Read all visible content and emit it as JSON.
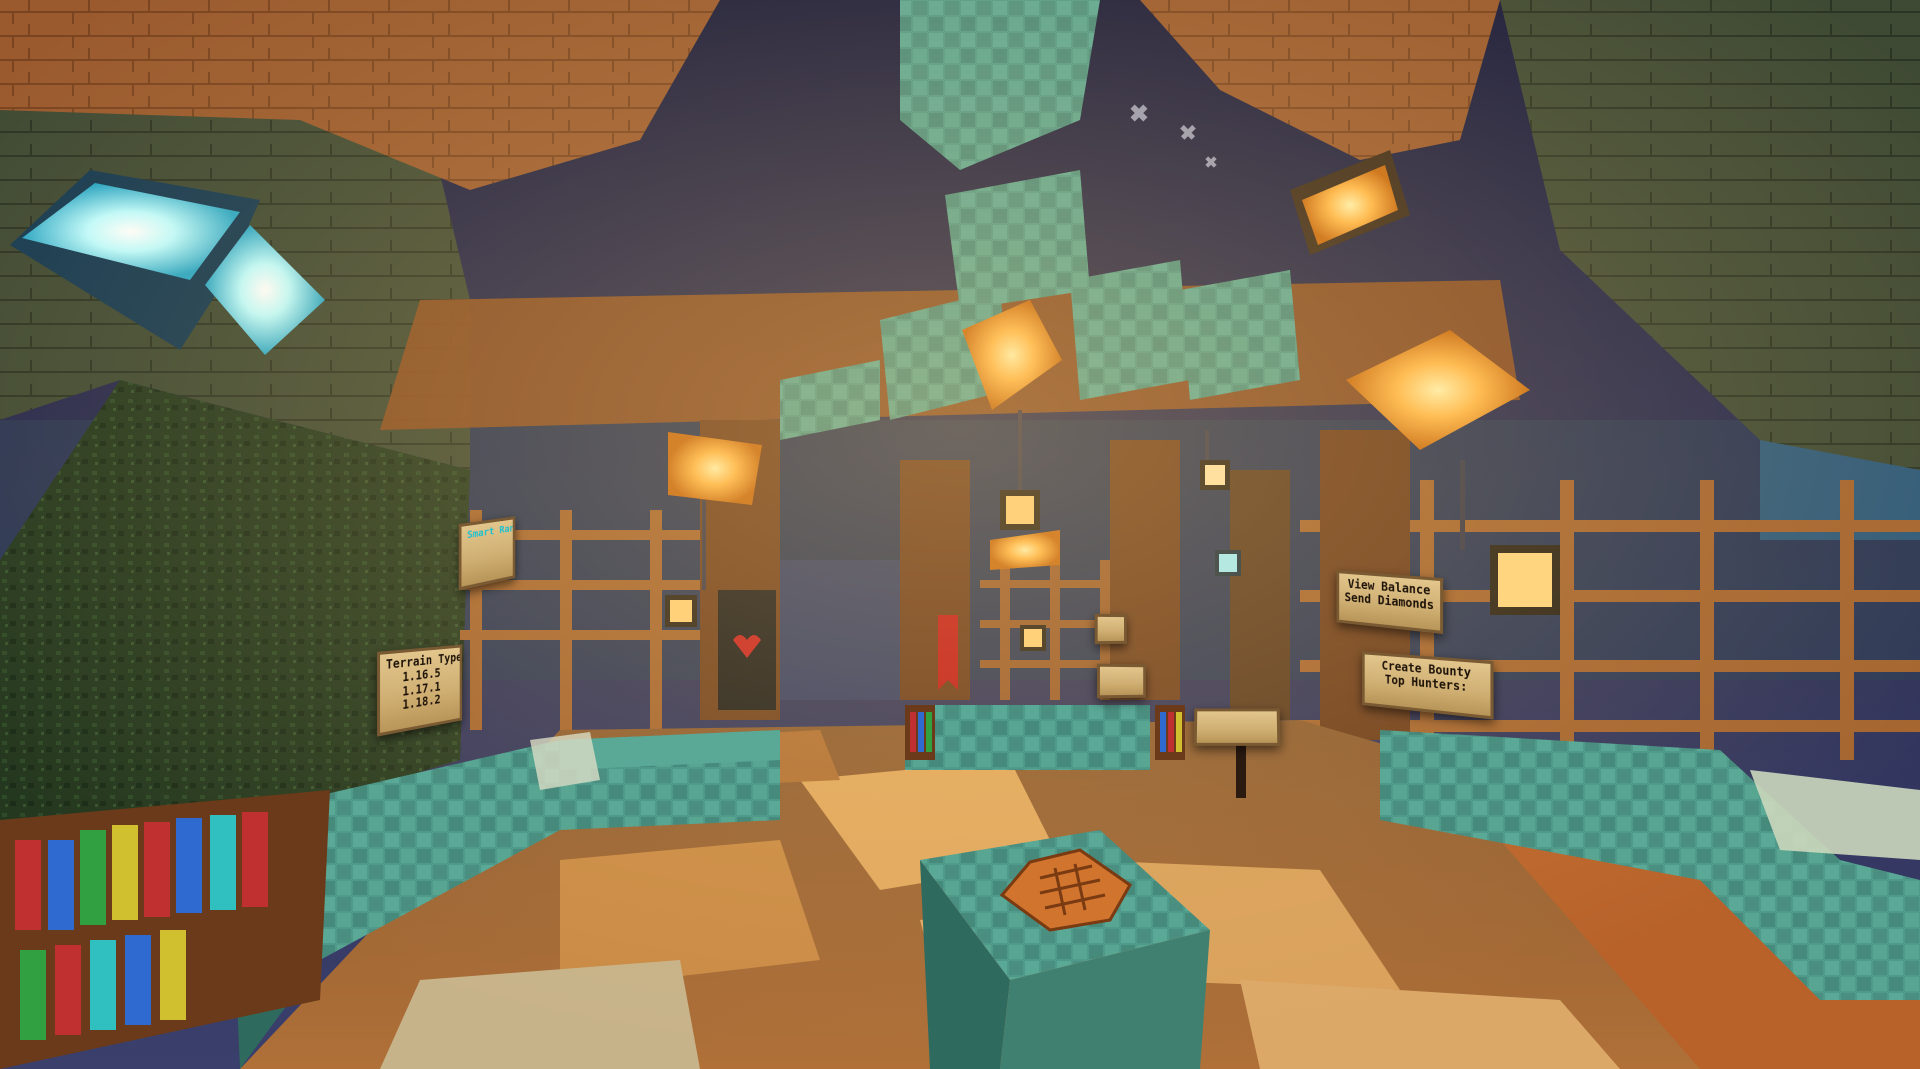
{
  "scene": {
    "title": "",
    "colors": {
      "sky": "#23264a",
      "wood_dark": "#6b3a1e",
      "wood_mid": "#9a5a2e",
      "wood_light": "#c9874a",
      "prismarine": "#4f9a8a",
      "prismarine_dark": "#2f6a5e",
      "glowstone": "#ffb84a",
      "sea_lantern": "#7ff6ff",
      "floor_light": "#d9a15c",
      "floor_dark": "#a05a2a",
      "banner_black": "#1c1c1c",
      "banner_red": "#c01818"
    },
    "icons": [
      "sea-lantern-icon",
      "glowstone-icon",
      "lantern-icon",
      "heart-banner-icon",
      "bookshelf-icon",
      "crafting-emblem-icon"
    ]
  },
  "signs": {
    "realm": {
      "lines": [
        "Terrain Type",
        "1.16.5",
        "1.17.1",
        "1.18.2"
      ]
    },
    "upper_left": {
      "lines": [
        "Smart Ranks",
        "",
        "",
        ""
      ]
    },
    "bank": {
      "lines": [
        "View Balance",
        "Send Diamonds",
        ""
      ]
    },
    "bounty": {
      "lines": [
        "Create Bounty",
        "",
        "Top Hunters:",
        ""
      ]
    },
    "center_small": {
      "lines": [
        "",
        ""
      ]
    },
    "center_mid": {
      "lines": [
        "",
        ""
      ]
    },
    "post": {
      "lines": [
        "",
        ""
      ]
    }
  }
}
